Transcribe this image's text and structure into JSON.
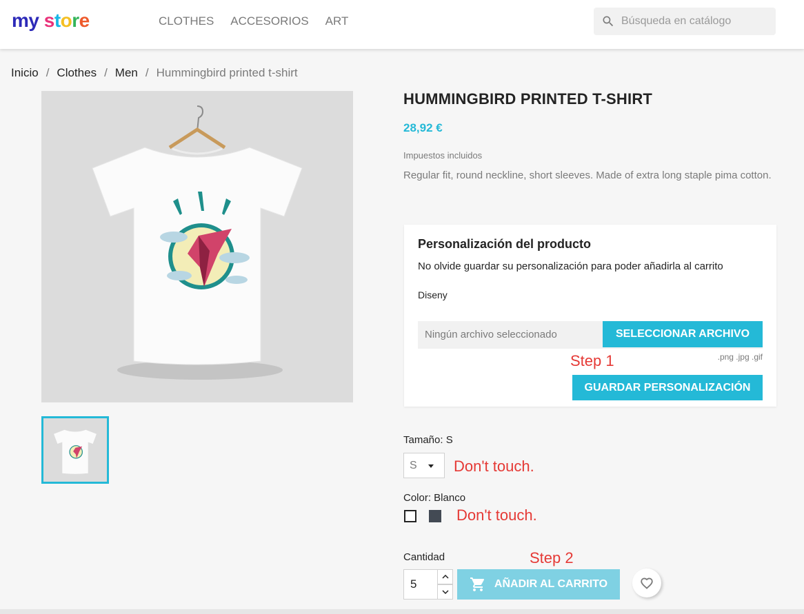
{
  "logo": {
    "part1": "my",
    "part2": "store"
  },
  "nav": [
    {
      "label": "CLOTHES"
    },
    {
      "label": "ACCESORIOS"
    },
    {
      "label": "ART"
    }
  ],
  "search": {
    "placeholder": "Búsqueda en catálogo",
    "icon": "search-icon"
  },
  "breadcrumb": [
    {
      "label": "Inicio"
    },
    {
      "label": "Clothes"
    },
    {
      "label": "Men"
    },
    {
      "label": "Hummingbird printed t-shirt"
    }
  ],
  "product": {
    "title": "HUMMINGBIRD PRINTED T-SHIRT",
    "price": "28,92 €",
    "tax_note": "Impuestos incluidos",
    "description": "Regular fit, round neckline, short sleeves. Made of extra long staple pima cotton."
  },
  "customization": {
    "title": "Personalización del producto",
    "note": "No olvide guardar su personalización para poder añadirla al carrito",
    "field_label": "Diseny",
    "file_placeholder": "Ningún archivo seleccionado",
    "select_file_label": "SELECCIONAR ARCHIVO",
    "file_hint": ".png .jpg .gif",
    "save_label": "GUARDAR PERSONALIZACIÓN"
  },
  "variants": {
    "size_label": "Tamaño: S",
    "size_value": "S",
    "color_label": "Color: Blanco",
    "colors": [
      {
        "name": "Blanco",
        "hex": "#ffffff",
        "selected": true
      },
      {
        "name": "Gris oscuro",
        "hex": "#434a54",
        "selected": false
      }
    ]
  },
  "quantity": {
    "label": "Cantidad",
    "value": "5"
  },
  "add_to_cart": {
    "label": "AÑADIR AL CARRITO"
  },
  "annotations": {
    "step1": "Step 1",
    "step2": "Step 2",
    "dont_touch_size": "Don't touch.",
    "dont_touch_color": "Don't touch."
  },
  "colors": {
    "accent": "#24b9d7",
    "annotation": "#e53935"
  }
}
